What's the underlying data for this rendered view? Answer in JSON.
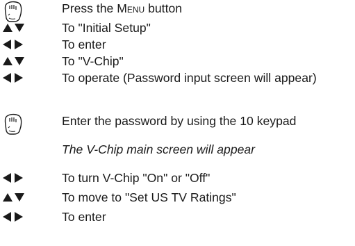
{
  "steps": [
    {
      "icon": "press-hand-icon",
      "text": "Press the ",
      "smallcaps": "Menu",
      "suffix": " button"
    },
    {
      "icon": "up-down-arrows-icon",
      "text": "To \"Initial Setup\""
    },
    {
      "icon": "left-right-arrows-icon",
      "text": "To enter"
    },
    {
      "icon": "up-down-arrows-icon",
      "text": "To \"V-Chip\""
    },
    {
      "icon": "left-right-arrows-icon",
      "text": "To operate (Password input screen will appear)"
    },
    {
      "icon": "press-hand-icon",
      "text": "Enter the password by using the 10 keypad"
    },
    {
      "icon": "",
      "text": "The V-Chip main screen will appear"
    },
    {
      "icon": "left-right-arrows-icon",
      "text": "To turn V-Chip \"On\" or \"Off\""
    },
    {
      "icon": "up-down-arrows-icon",
      "text": "To move to \"Set US TV Ratings\""
    },
    {
      "icon": "left-right-arrows-icon",
      "text": "To enter"
    }
  ]
}
